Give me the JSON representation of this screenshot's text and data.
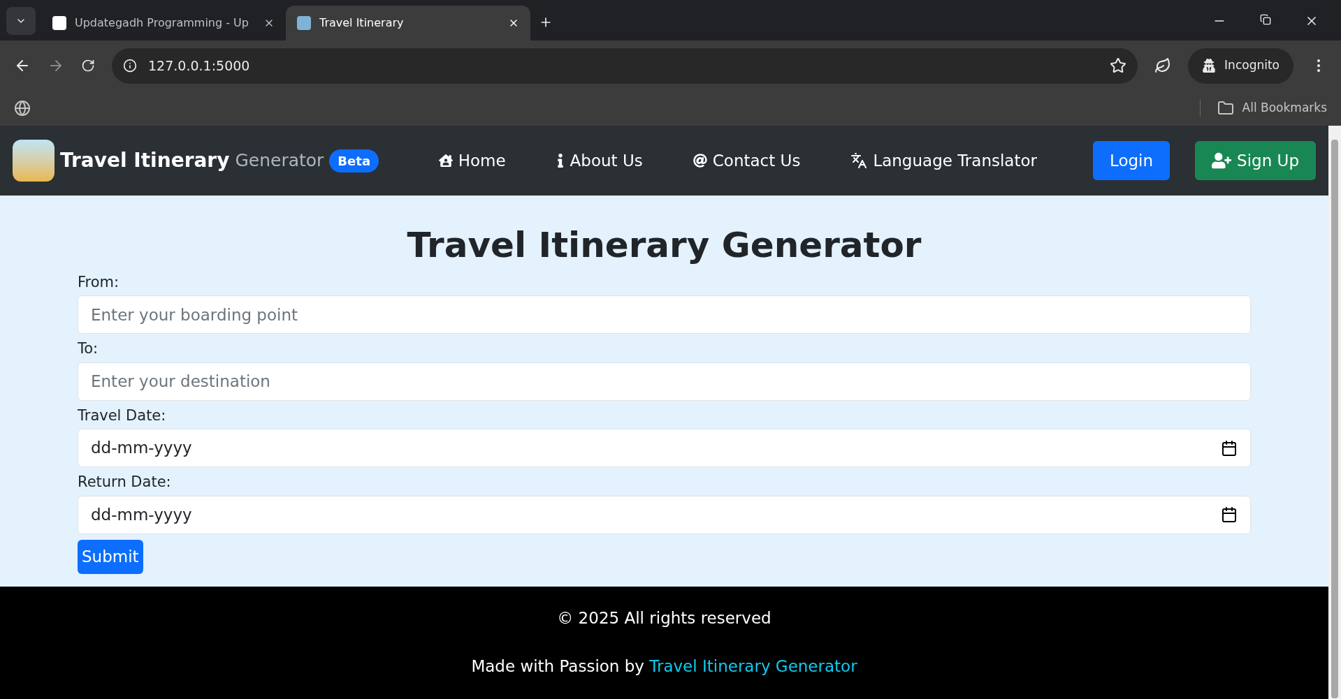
{
  "browser": {
    "tabs": [
      {
        "title": "Updategadh Programming - Up",
        "selected": false
      },
      {
        "title": "Travel Itinerary",
        "selected": true
      }
    ],
    "address": "127.0.0.1:5000",
    "profile": "Incognito",
    "bookmarks_label": "All Bookmarks"
  },
  "navbar": {
    "brand_bold": "Travel Itinerary",
    "brand_light": "Generator",
    "badge": "Beta",
    "links": [
      {
        "kind": "home",
        "label": "Home"
      },
      {
        "kind": "info",
        "label": "About Us"
      },
      {
        "kind": "at",
        "label": "Contact Us"
      },
      {
        "kind": "translate",
        "label": "Language Translator"
      }
    ],
    "login": "Login",
    "signup": "Sign Up"
  },
  "form": {
    "title": "Travel Itinerary Generator",
    "fields": [
      {
        "kind": "text",
        "label": "From:",
        "placeholder": "Enter your boarding point"
      },
      {
        "kind": "text",
        "label": "To:",
        "placeholder": "Enter your destination"
      },
      {
        "kind": "date",
        "label": "Travel Date:",
        "placeholder": "dd-mm-yyyy"
      },
      {
        "kind": "date",
        "label": "Return Date:",
        "placeholder": "dd-mm-yyyy"
      }
    ],
    "submit": "Submit"
  },
  "footer": {
    "copyright": "© 2025 All rights reserved",
    "made_with": "Made with Passion by",
    "link": "Travel Itinerary Generator"
  }
}
